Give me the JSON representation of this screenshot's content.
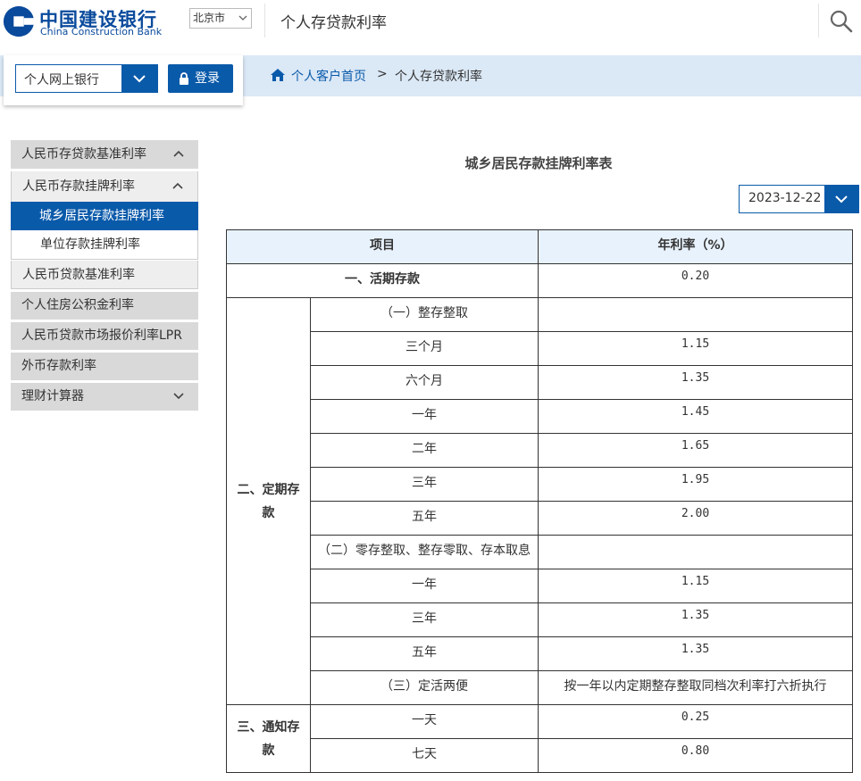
{
  "header": {
    "logo_cn": "中国建设银行",
    "logo_en": "China Construction Bank",
    "city": "北京市",
    "page_title": "个人存贷款利率"
  },
  "login": {
    "bank_select": "个人网上银行",
    "login_label": "登录"
  },
  "breadcrumb": {
    "home": "个人客户首页",
    "separator": ">",
    "current": "个人存贷款利率"
  },
  "sidebar": {
    "items": [
      {
        "label": "人民币存贷款基准利率",
        "icon": "chevron-up-icon"
      },
      {
        "label": "人民币存款挂牌利率",
        "icon": "chevron-up-icon"
      },
      {
        "label": "城乡居民存款挂牌利率",
        "active": true
      },
      {
        "label": "单位存款挂牌利率"
      },
      {
        "label": "人民币贷款基准利率"
      },
      {
        "label": "个人住房公积金利率"
      },
      {
        "label": "人民币贷款市场报价利率LPR"
      },
      {
        "label": "外币存款利率"
      },
      {
        "label": "理财计算器",
        "icon": "chevron-down-icon"
      }
    ]
  },
  "main": {
    "table_title": "城乡居民存款挂牌利率表",
    "date": "2023-12-22",
    "table": {
      "headers": [
        "项目",
        "年利率（%）"
      ],
      "demand": {
        "label": "一、活期存款",
        "rate": "0.20"
      },
      "fixed_group": "二、定期存款",
      "fixed_rows": [
        {
          "item": "（一）整存整取",
          "rate": ""
        },
        {
          "item": "三个月",
          "rate": "1.15"
        },
        {
          "item": "六个月",
          "rate": "1.35"
        },
        {
          "item": "一年",
          "rate": "1.45"
        },
        {
          "item": "二年",
          "rate": "1.65"
        },
        {
          "item": "三年",
          "rate": "1.95"
        },
        {
          "item": "五年",
          "rate": "2.00"
        },
        {
          "item": "（二）零存整取、整存零取、存本取息",
          "rate": ""
        },
        {
          "item": "一年",
          "rate": "1.15"
        },
        {
          "item": "三年",
          "rate": "1.35"
        },
        {
          "item": "五年",
          "rate": "1.35"
        },
        {
          "item": "（三）定活两便",
          "rate": "按一年以内定期整存整取同档次利率打六折执行"
        }
      ],
      "notice_group": "三、通知存款",
      "notice_rows": [
        {
          "item": "一天",
          "rate": "0.25"
        },
        {
          "item": "七天",
          "rate": "0.80"
        }
      ]
    }
  },
  "colors": {
    "brand": "#0a5aaa",
    "logo": "#0a4a9c",
    "band": "#dbe8f6",
    "table_header": "#e8f2fc"
  }
}
